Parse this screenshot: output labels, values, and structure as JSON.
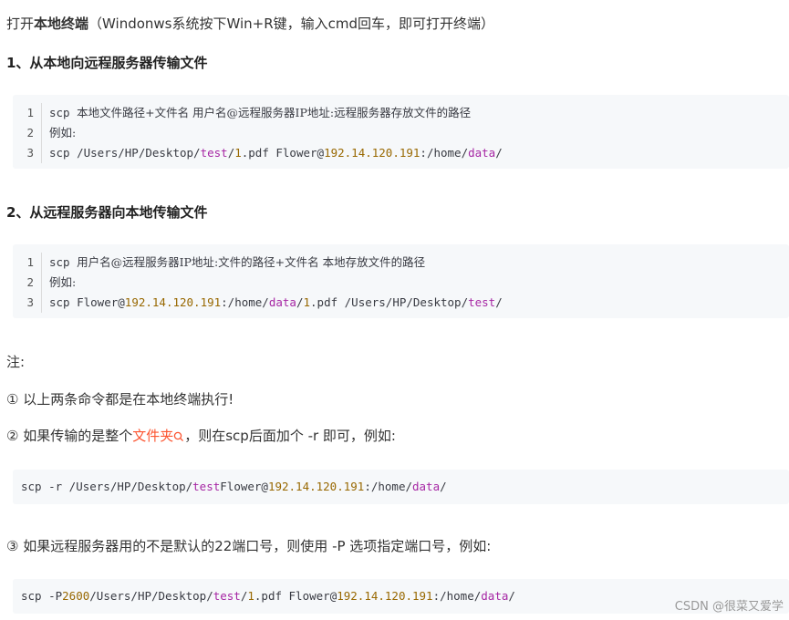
{
  "intro": {
    "prefix": "打开",
    "bold": "本地终端",
    "suffix": "（Windonws系统按下Win+R键，输入cmd回车，即可打开终端）"
  },
  "section1": {
    "heading": "1、从本地向远程服务器传输文件",
    "lines": [
      {
        "n": "1",
        "a": "scp ",
        "b": "本地文件路径+文件名 用户名@远程服务器IP地址:远程服务器存放文件的路径"
      },
      {
        "n": "2",
        "b": "例如:"
      },
      {
        "n": "3",
        "p1": "scp /Users/HP/Desktop/",
        "k1": "test",
        "p2": "/",
        "n1": "1",
        "p3": ".pdf Flower@",
        "ip": "192.14.120.191",
        "p4": ":/home/",
        "k2": "data",
        "p5": "/"
      }
    ]
  },
  "section2": {
    "heading": "2、从远程服务器向本地传输文件",
    "lines": [
      {
        "n": "1",
        "a": "scp ",
        "b": "用户名@远程服务器IP地址:文件的路径+文件名 本地存放文件的路径"
      },
      {
        "n": "2",
        "b": "例如:"
      },
      {
        "n": "3",
        "p1": "scp Flower@",
        "ip": "192.14.120.191",
        "p2": ":/home/",
        "k1": "data",
        "p3": "/",
        "n1": "1",
        "p4": ".pdf /Users/HP/Desktop/",
        "k2": "test",
        "p5": "/"
      }
    ]
  },
  "notes": {
    "label": "注:",
    "note1": "① 以上两条命令都是在本地终端执行!",
    "note2_prefix": "② 如果传输的是整个",
    "note2_link": "文件夹",
    "note2_suffix": "，则在scp后面加个 -r 即可，例如:",
    "note3": "③ 如果远程服务器用的不是默认的22端口号，则使用 -P 选项指定端口号，例如:"
  },
  "code_r": {
    "p1": "scp -r /Users/HP/Desktop/",
    "k1": "test",
    "p2": " Flower@",
    "ip": "192.14.120.191",
    "p3": ":/home/",
    "k2": "data",
    "p4": "/"
  },
  "code_p": {
    "p1": "scp -P ",
    "port": "2600",
    "p2": " /Users/HP/Desktop/",
    "k1": "test",
    "p3": "/",
    "n1": "1",
    "p4": ".pdf Flower@",
    "ip": "192.14.120.191",
    "p5": ":/home/",
    "k2": "data",
    "p6": "/"
  },
  "watermark": "CSDN @很菜又爱学",
  "colors": {
    "link": "#fc5531",
    "number": "#986801",
    "keyword": "#a626a4",
    "code_bg": "#f6f8fa"
  },
  "icons": {
    "search": "search-icon"
  }
}
